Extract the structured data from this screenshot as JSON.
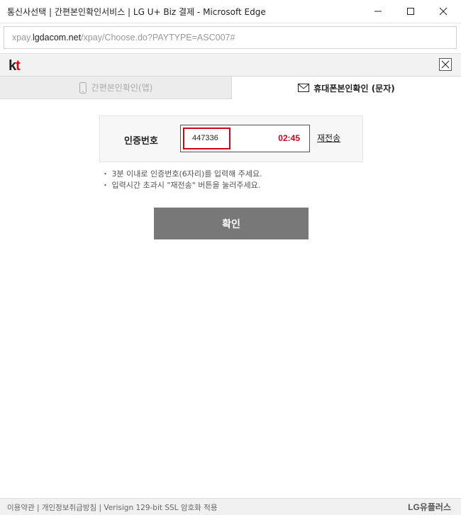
{
  "window": {
    "title": "통신사선택 | 간편본인확인서비스 | LG U+ Biz 결제 - Microsoft Edge"
  },
  "address_bar": {
    "url_prefix": "xpay.",
    "url_domain": "lgdacom.net",
    "url_path": "/xpay/Choose.do?PAYTYPE=ASC007#"
  },
  "header": {
    "logo_k": "k",
    "logo_t": "t"
  },
  "tabs": [
    {
      "label": "간편본인확인(앱)",
      "active": false
    },
    {
      "label": "휴대폰본인확인 (문자)",
      "active": true
    }
  ],
  "verification": {
    "label": "인증번호",
    "code_value": "447336",
    "timer": "02:45",
    "resend_label": "재전송"
  },
  "notes": [
    "・ 3분 이내로 인증번호(6자리)를 입력해 주세요.",
    "・ 입력시간 초과시 \"재전송\" 버튼을 눌러주세요."
  ],
  "confirm_label": "확인",
  "footer": {
    "links": "이용약관 | 개인정보취급방침 | Verisign 129-bit SSL 암호화 적용",
    "brand": "LG유플러스"
  },
  "colors": {
    "accent_red": "#d0021b",
    "button_gray": "#787878"
  }
}
